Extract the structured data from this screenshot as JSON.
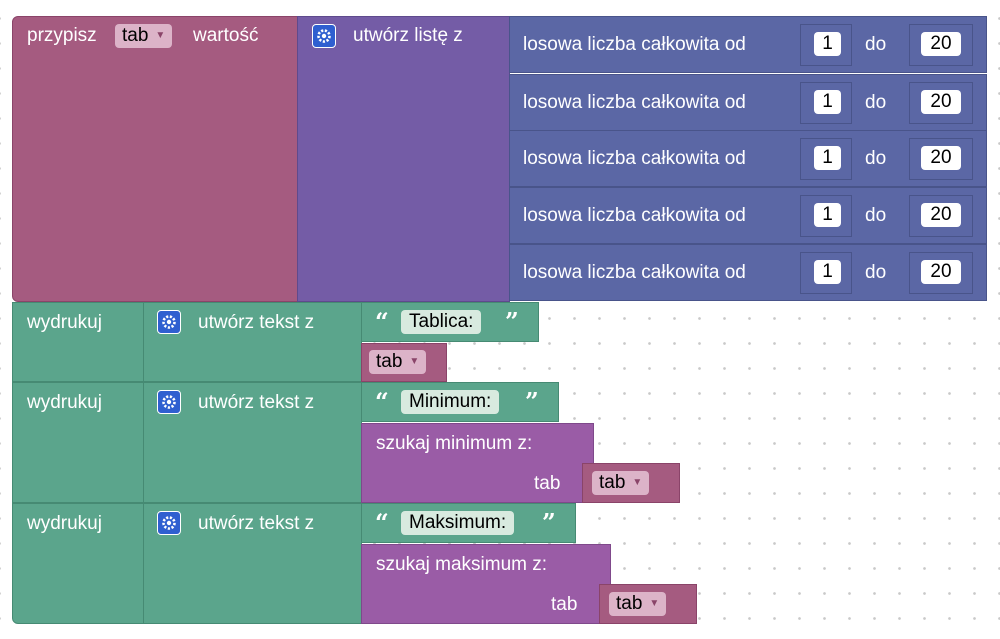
{
  "assign": {
    "keyword": "przypisz",
    "variable": "tab",
    "suffix": "wartość"
  },
  "create_list": {
    "label": "utwórz listę z"
  },
  "random_items": [
    {
      "label": "losowa liczba całkowita od",
      "from": "1",
      "to_label": "do",
      "to": "20"
    },
    {
      "label": "losowa liczba całkowita od",
      "from": "1",
      "to_label": "do",
      "to": "20"
    },
    {
      "label": "losowa liczba całkowita od",
      "from": "1",
      "to_label": "do",
      "to": "20"
    },
    {
      "label": "losowa liczba całkowita od",
      "from": "1",
      "to_label": "do",
      "to": "20"
    },
    {
      "label": "losowa liczba całkowita od",
      "from": "1",
      "to_label": "do",
      "to": "20"
    }
  ],
  "prints": [
    {
      "keyword": "wydrukuj",
      "join_label": "utwórz tekst z",
      "text": "Tablica:",
      "variable": "tab"
    },
    {
      "keyword": "wydrukuj",
      "join_label": "utwórz tekst z",
      "text": "Minimum:",
      "func_label": "szukaj minimum  z:",
      "arg_label": "tab",
      "variable": "tab"
    },
    {
      "keyword": "wydrukuj",
      "join_label": "utwórz tekst z",
      "text": "Maksimum:",
      "func_label": "szukaj maksimum  z:",
      "arg_label": "tab",
      "variable": "tab"
    }
  ],
  "quote_open": "“",
  "quote_close": "”",
  "icons": {
    "mutator": "gear-icon",
    "dropdown": "triangle-down-icon"
  },
  "colors": {
    "variables": "#a55b80",
    "lists": "#745ca6",
    "math": "#5b67a5",
    "text": "#5ba58c",
    "functions": "#9a5ca6"
  }
}
